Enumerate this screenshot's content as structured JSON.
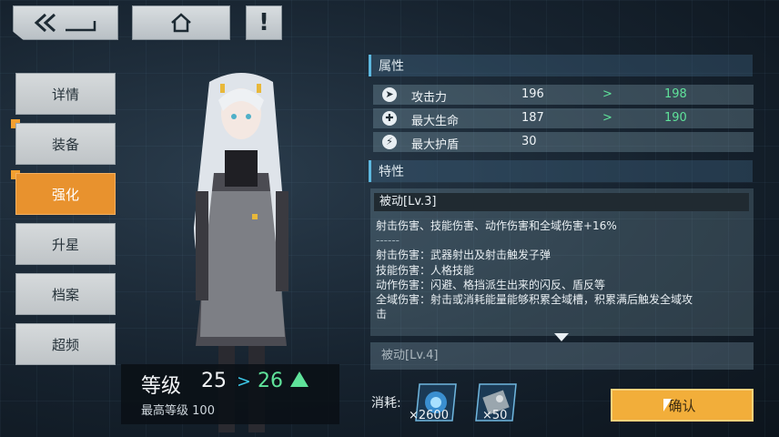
{
  "nav": [
    "详情",
    "装备",
    "强化",
    "升星",
    "档案",
    "超频"
  ],
  "alert_label": "!",
  "level": {
    "label": "等级",
    "current": "25",
    "arrow": ">",
    "next": "26",
    "max_label": "最高等级",
    "max_value": "100"
  },
  "attributes": {
    "header": "属性",
    "rows": [
      {
        "icon": "attack-icon",
        "name": "攻击力",
        "value": "196",
        "arrow": ">",
        "new_value": "198"
      },
      {
        "icon": "health-icon",
        "name": "最大生命",
        "value": "187",
        "arrow": ">",
        "new_value": "190"
      },
      {
        "icon": "shield-icon",
        "name": "最大护盾",
        "value": "30"
      }
    ]
  },
  "trait": {
    "header": "特性",
    "title": "被动[Lv.3]",
    "summary": "射击伤害、技能伤害、动作伤害和全域伤害+16%",
    "divider": "------",
    "lines": [
      "射击伤害：武器射出及射击触发子弹",
      "技能伤害：人格技能",
      "动作伤害：闪避、格挡派生出来的闪反、盾反等",
      "全域伤害：射击或消耗能量能够积累全域槽，积累满后触发全域攻",
      "击"
    ],
    "next": "被动[Lv.4]"
  },
  "cost": {
    "label": "消耗:",
    "items": [
      {
        "icon": "exp-core-icon",
        "count": "×2600"
      },
      {
        "icon": "gear-material-icon",
        "count": "×50"
      }
    ]
  },
  "confirm_label": "确认",
  "colors": {
    "accent": "#f2ae3a",
    "nav_active": "#e8922e",
    "increase": "#5fe29a",
    "arrow": "#3ec8e8"
  }
}
